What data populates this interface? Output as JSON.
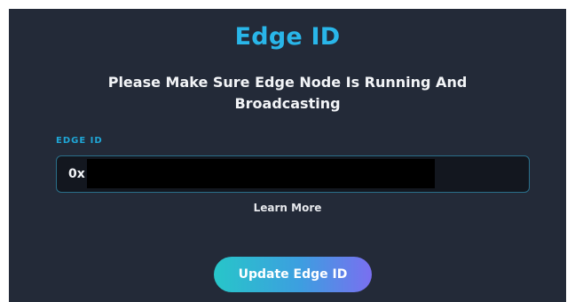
{
  "header": {
    "title": "Edge ID",
    "message": "Please Make Sure Edge Node Is Running And Broadcasting"
  },
  "edge_id_field": {
    "label": "EDGE ID",
    "value_prefix": "0x",
    "value_redacted": true
  },
  "links": {
    "learn_more": "Learn More"
  },
  "actions": {
    "update_label": "Update Edge ID"
  },
  "colors": {
    "panel_bg": "#232a38",
    "title": "#29b6e9",
    "label": "#1fa6d6",
    "input_bg": "#13171f",
    "input_border": "#2a6f8a",
    "button_gradient_start": "#27c6c9",
    "button_gradient_end": "#7a6ff0"
  }
}
